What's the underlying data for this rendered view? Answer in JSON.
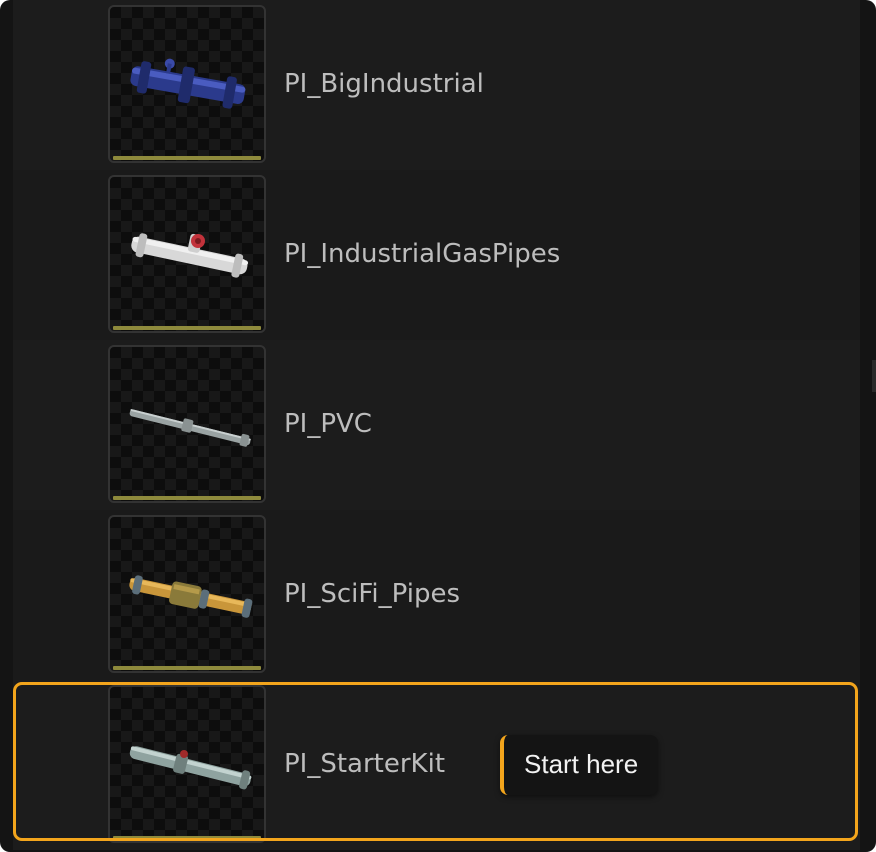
{
  "assets": [
    {
      "label": "PI_BigIndustrial",
      "icon": "blue-industrial-pipe-icon"
    },
    {
      "label": "PI_IndustrialGasPipes",
      "icon": "white-gas-pipe-with-red-valve-icon"
    },
    {
      "label": "PI_PVC",
      "icon": "grey-pvc-pipe-icon"
    },
    {
      "label": "PI_SciFi_Pipes",
      "icon": "orange-scifi-pipe-icon"
    },
    {
      "label": "PI_StarterKit",
      "icon": "starter-kit-pipe-icon"
    }
  ],
  "callout": {
    "text": "Start here"
  },
  "colors": {
    "highlight": "#f3a51c",
    "thumbnail_bar": "#8e8a3c"
  }
}
